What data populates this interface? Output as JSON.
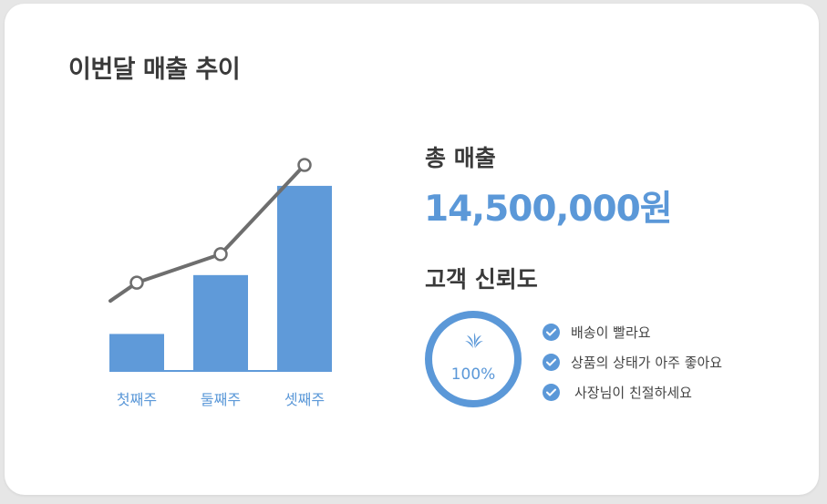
{
  "title": "이번달 매출 추이",
  "summary": {
    "sales_label": "총 매출",
    "sales_value": "14,500,000원"
  },
  "trust": {
    "label": "고객 신뢰도",
    "badge_text": "100%",
    "badge_icon": "sprout-icon",
    "reviews": [
      "배송이 빨라요",
      "상품의 상태가 아주 좋아요",
      "사장님이 친절하세요"
    ]
  },
  "colors": {
    "accent": "#5b98d8",
    "bar": "#5f9ad9",
    "line": "#6e6e6e",
    "title": "#3a3a3a"
  },
  "chart_data": {
    "type": "bar",
    "categories": [
      "첫째주",
      "둘째주",
      "셋째주"
    ],
    "values": [
      1.9,
      5.0,
      9.7
    ],
    "trend_line_values": [
      4.6,
      6.1,
      10.8
    ],
    "ylim": [
      0,
      12
    ],
    "grid": false,
    "legend": "none",
    "title": "",
    "xlabel": "",
    "ylabel": ""
  }
}
